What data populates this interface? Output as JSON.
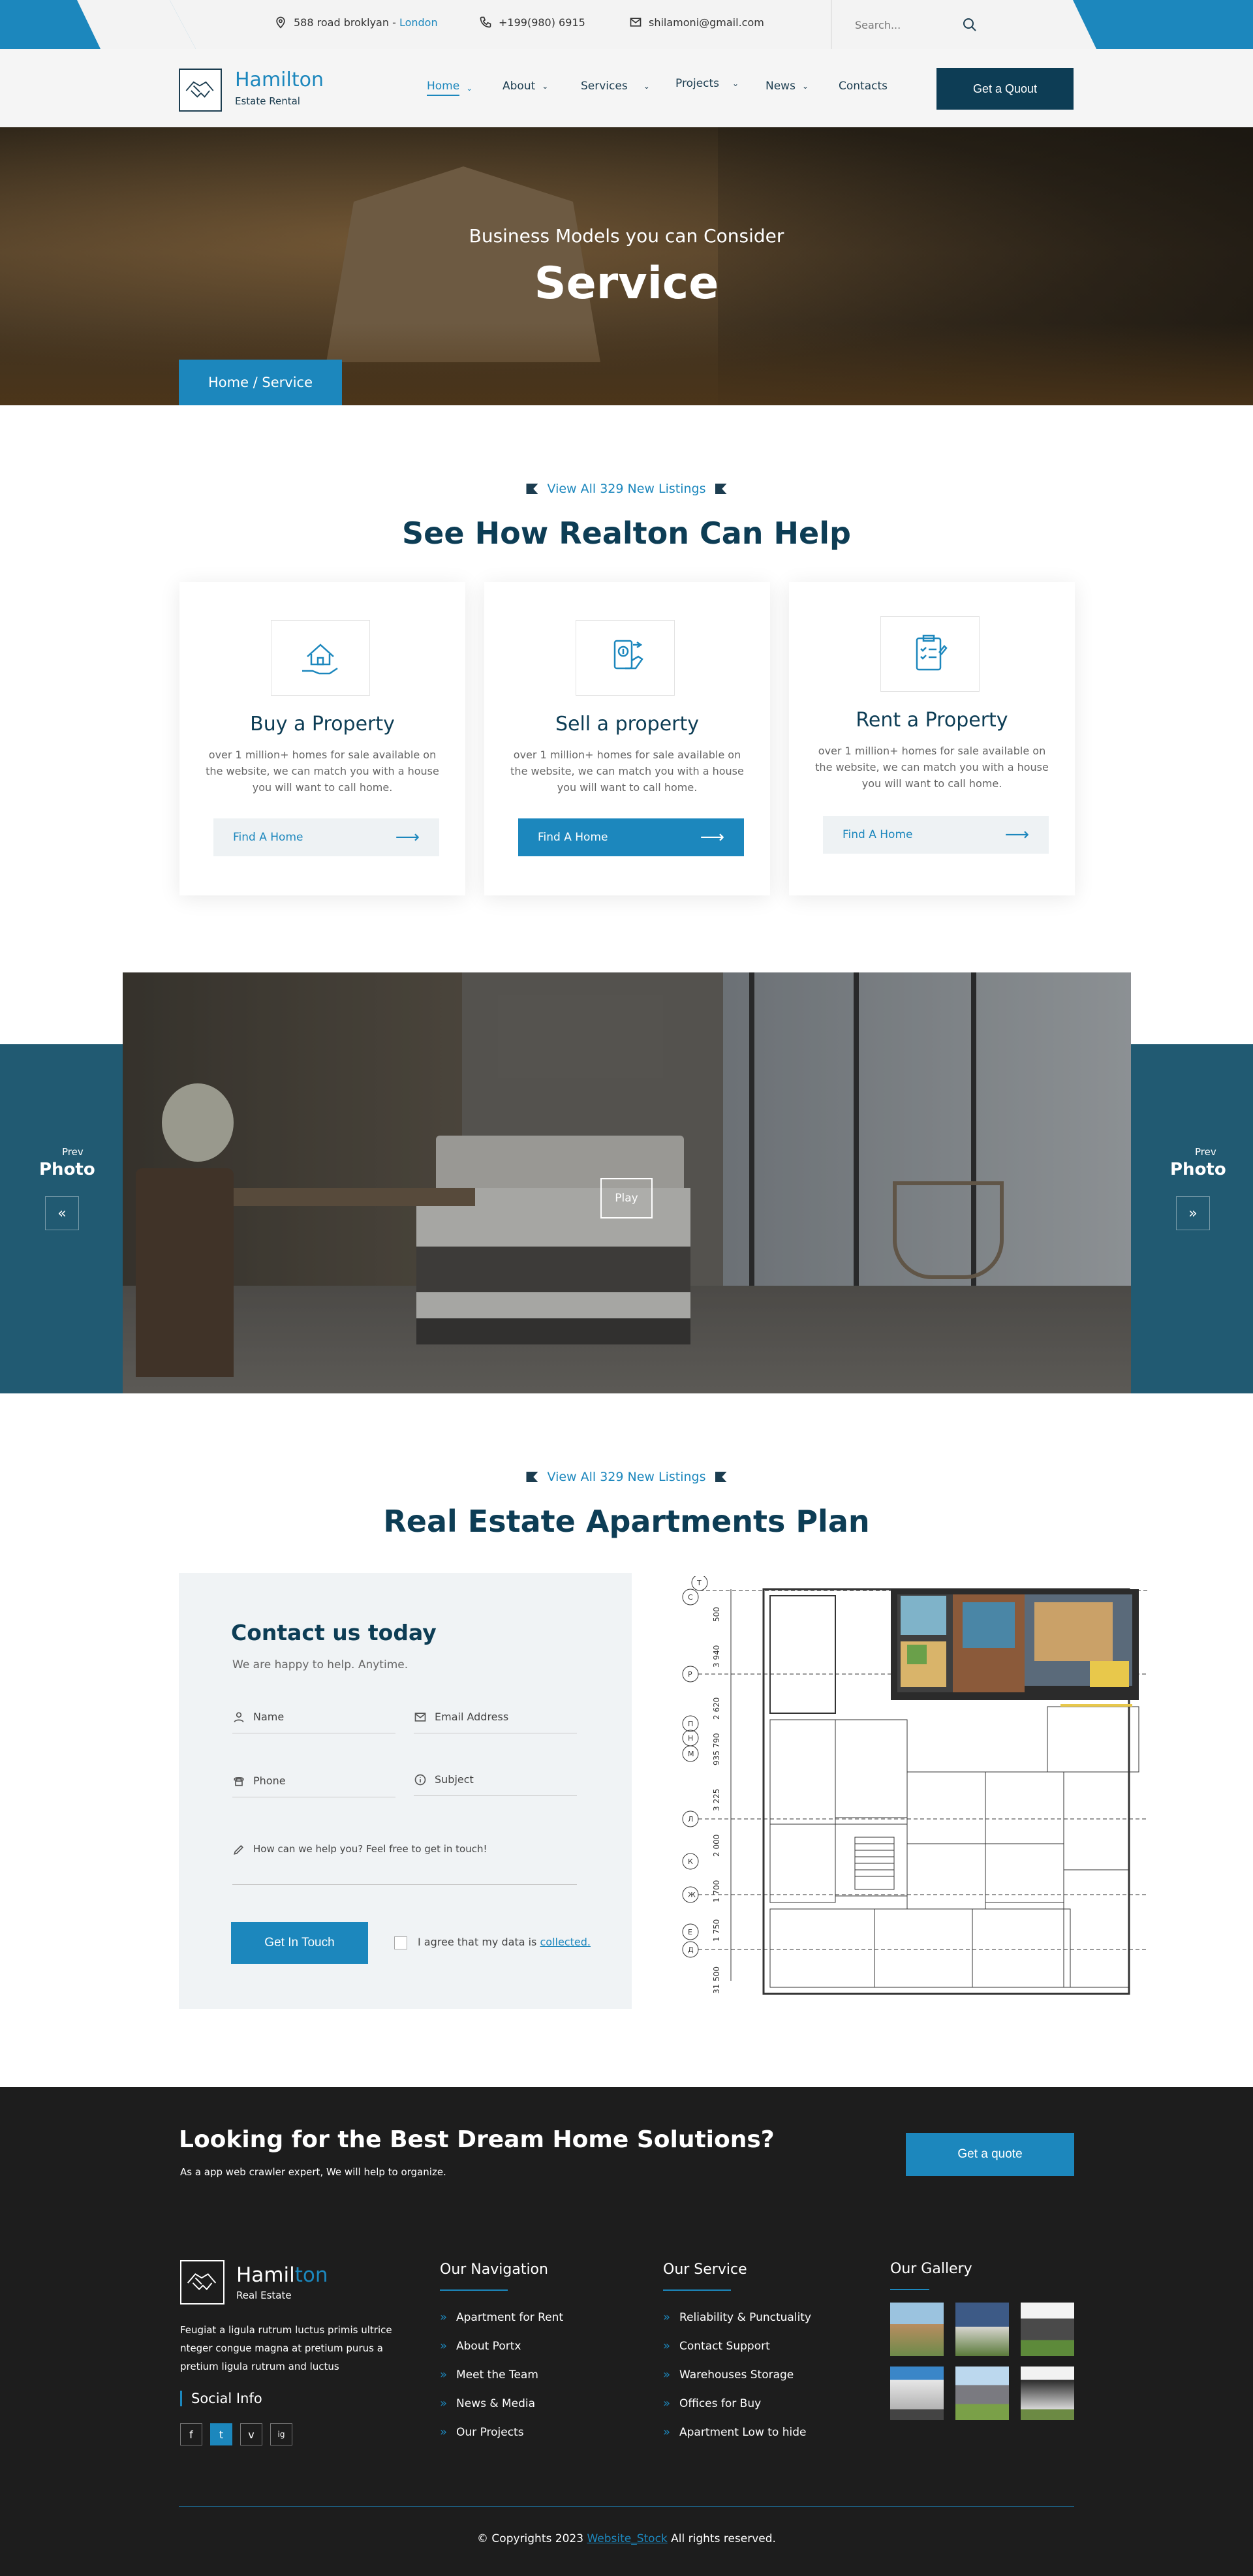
{
  "topbar": {
    "address": "588 road broklyan -",
    "city": "London",
    "phone": "+199(980) 6915",
    "email": "shilamoni@gmail.com",
    "search_placeholder": "Search..."
  },
  "header": {
    "logo_name": "Hamilton",
    "logo_sub": "Estate Rental",
    "nav": [
      {
        "label": "Home"
      },
      {
        "label": "About"
      },
      {
        "label": "Services"
      },
      {
        "label": "Projects"
      },
      {
        "label": "News"
      },
      {
        "label": "Contacts"
      }
    ],
    "quote_btn": "Get a Quout"
  },
  "hero": {
    "subtitle": "Business Models you can Consider",
    "title": "Service",
    "breadcrumb": "Home / Service"
  },
  "services": {
    "kicker": "View All 329 New Listings",
    "title": "See How Realton Can Help",
    "cards": [
      {
        "icon": "house-hand-icon",
        "title": "Buy a Property",
        "text": "over 1 million+ homes for sale available on the website, we can match you with a house you will want to call home.",
        "btn": "Find A Home"
      },
      {
        "icon": "sell-phone-icon",
        "title": "Sell a property",
        "text": "over 1 million+ homes for sale available on the website, we can match you with a house you will want to call home.",
        "btn": "Find A Home"
      },
      {
        "icon": "clipboard-check-icon",
        "title": "Rent a Property",
        "text": "over 1 million+ homes for sale available on the website, we can match you with a house you will want to call home.",
        "btn": "Find A Home"
      }
    ]
  },
  "slider": {
    "left_prev": "Prev",
    "left_label": "Photo",
    "right_prev": "Prev",
    "right_label": "Photo",
    "play": "Play"
  },
  "plan": {
    "kicker": "View All 329 New Listings",
    "title": "Real Estate Apartments Plan"
  },
  "contact": {
    "title": "Contact us today",
    "subtitle": "We are happy to help. Anytime.",
    "name_placeholder": "Name",
    "email_placeholder": "Email Address",
    "phone_placeholder": "Phone",
    "subject_placeholder": "Subject",
    "message_placeholder": "How can we help you? Feel free to get in touch!",
    "submit": "Get In Touch",
    "agree": "I agree that my data is",
    "agree_link": "collected."
  },
  "cta": {
    "title": "Looking for the Best Dream Home Solutions?",
    "subtitle": "As a app web crawler expert, We will help to organize.",
    "btn": "Get a quote"
  },
  "footer": {
    "logo_name_a": "Hamil",
    "logo_name_b": "ton",
    "logo_sub": "Real Estate",
    "desc": "Feugiat a ligula rutrum luctus primis ultrice nteger congue magna at pretium purus a pretium ligula rutrum and luctus",
    "social_title": "Social Info",
    "social": [
      "f",
      "t",
      "v",
      "ig"
    ],
    "nav_title": "Our Navigation",
    "nav_items": [
      "Apartment for Rent",
      "About Portx",
      "Meet the Team",
      "News & Media",
      "Our Projects"
    ],
    "service_title": "Our Service",
    "service_items": [
      "Reliability & Punctuality",
      "Contact Support",
      "Warehouses Storage",
      "Offices for Buy",
      "Apartment Low to hide"
    ],
    "gallery_title": "Our Gallery",
    "copyright_a": "© Copyrights 2023",
    "copyright_link": "Website_Stock",
    "copyright_b": "All rights reserved."
  },
  "colors": {
    "accent": "#1c87bd",
    "navy": "#0d3d55",
    "teal_band": "#215a72",
    "dark": "#1d1d1d"
  }
}
